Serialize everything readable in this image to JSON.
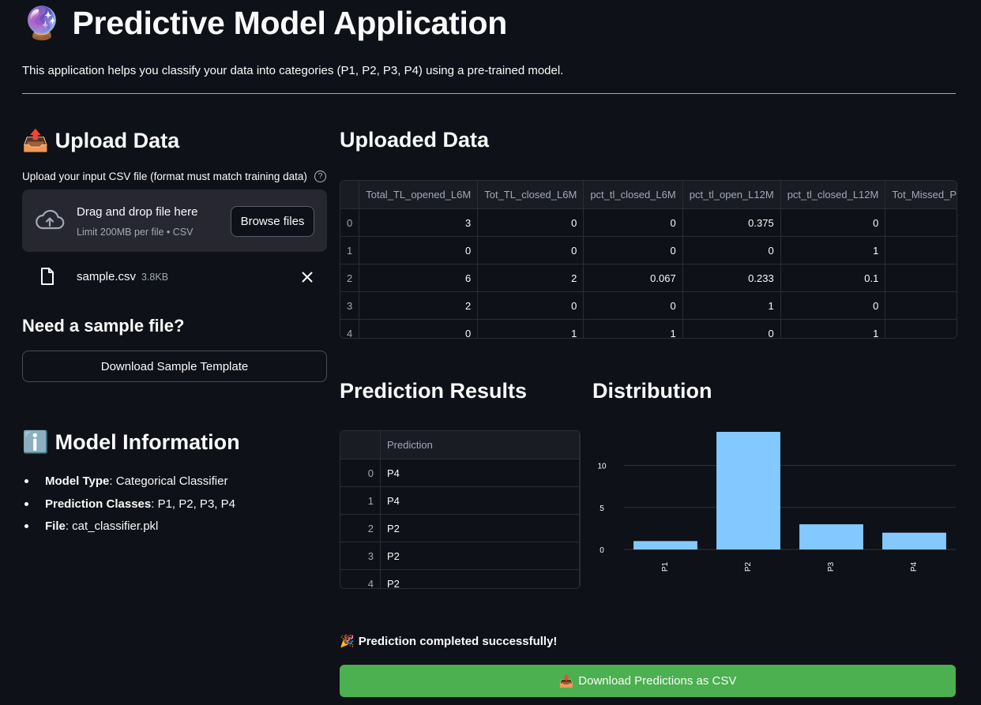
{
  "header": {
    "emoji": "🔮",
    "title": "Predictive Model Application",
    "subtitle": "This application helps you classify your data into categories (P1, P2, P3, P4) using a pre-trained model."
  },
  "upload": {
    "emoji": "📤",
    "title": "Upload Data",
    "label": "Upload your input CSV file (format must match training data)",
    "help": "?",
    "drop_title": "Drag and drop file here",
    "drop_limit": "Limit 200MB per file • CSV",
    "browse_label": "Browse files",
    "file_name": "sample.csv",
    "file_size": "3.8KB"
  },
  "sample": {
    "title": "Need a sample file?",
    "button_label": "Download Sample Template"
  },
  "model_info": {
    "emoji": "ℹ️",
    "title": "Model Information",
    "items": [
      {
        "key": "Model Type",
        "value": ": Categorical Classifier"
      },
      {
        "key": "Prediction Classes",
        "value": ": P1, P2, P3, P4"
      },
      {
        "key": "File",
        "value": ": cat_classifier.pkl"
      }
    ]
  },
  "uploaded_data": {
    "title": "Uploaded Data",
    "columns": [
      "Total_TL_opened_L6M",
      "Tot_TL_closed_L6M",
      "pct_tl_closed_L6M",
      "pct_tl_open_L12M",
      "pct_tl_closed_L12M",
      "Tot_Missed_Pmnt"
    ],
    "rows": [
      {
        "index": "0",
        "cells": [
          "3",
          "0",
          "0",
          "0.375",
          "0",
          ""
        ]
      },
      {
        "index": "1",
        "cells": [
          "0",
          "0",
          "0",
          "0",
          "1",
          ""
        ]
      },
      {
        "index": "2",
        "cells": [
          "6",
          "2",
          "0.067",
          "0.233",
          "0.1",
          ""
        ]
      },
      {
        "index": "3",
        "cells": [
          "2",
          "0",
          "0",
          "1",
          "0",
          ""
        ]
      },
      {
        "index": "4",
        "cells": [
          "0",
          "1",
          "1",
          "0",
          "1",
          ""
        ]
      }
    ]
  },
  "predictions": {
    "title": "Prediction Results",
    "column": "Prediction",
    "rows": [
      {
        "index": "0",
        "value": "P4"
      },
      {
        "index": "1",
        "value": "P4"
      },
      {
        "index": "2",
        "value": "P2"
      },
      {
        "index": "3",
        "value": "P2"
      },
      {
        "index": "4",
        "value": "P2"
      }
    ]
  },
  "distribution": {
    "title": "Distribution"
  },
  "chart_data": {
    "type": "bar",
    "categories": [
      "P1",
      "P2",
      "P3",
      "P4"
    ],
    "values": [
      1,
      14,
      3,
      2
    ],
    "yticks": [
      0,
      5,
      10
    ],
    "ylim": [
      0,
      14
    ],
    "color": "#83c9ff",
    "grid": true
  },
  "status": {
    "emoji": "🎉",
    "message": "Prediction completed successfully!"
  },
  "download": {
    "emoji": "📥",
    "label": "Download Predictions as CSV",
    "color": "#4caf50"
  }
}
